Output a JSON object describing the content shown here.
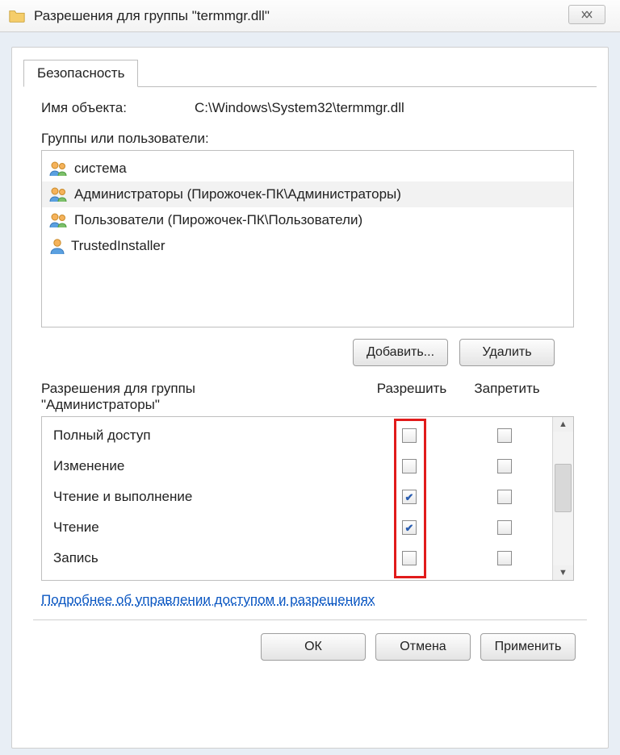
{
  "title": "Разрешения для группы \"termmgr.dll\"",
  "tab": "Безопасность",
  "object": {
    "label": "Имя объекта:",
    "path": "C:\\Windows\\System32\\termmgr.dll"
  },
  "groups": {
    "label": "Группы или пользователи:",
    "items": [
      {
        "name": "система",
        "icon": "users"
      },
      {
        "name": "Администраторы (Пирожочек-ПК\\Администраторы)",
        "icon": "users",
        "selected": true
      },
      {
        "name": "Пользователи (Пирожочек-ПК\\Пользователи)",
        "icon": "users"
      },
      {
        "name": "TrustedInstaller",
        "icon": "user"
      }
    ]
  },
  "btn_add": "Добавить...",
  "btn_remove": "Удалить",
  "perm_title_prefix": "Разрешения для группы",
  "perm_title_subject": "\"Администраторы\"",
  "col_allow": "Разрешить",
  "col_deny": "Запретить",
  "permissions": [
    {
      "name": "Полный доступ",
      "allow": false,
      "deny": false
    },
    {
      "name": "Изменение",
      "allow": false,
      "deny": false
    },
    {
      "name": "Чтение и выполнение",
      "allow": true,
      "deny": false
    },
    {
      "name": "Чтение",
      "allow": true,
      "deny": false
    },
    {
      "name": "Запись",
      "allow": false,
      "deny": false
    }
  ],
  "link": "Подробнее об управлении доступом и разрешениях",
  "btn_ok": "ОК",
  "btn_cancel": "Отмена",
  "btn_apply": "Применить"
}
